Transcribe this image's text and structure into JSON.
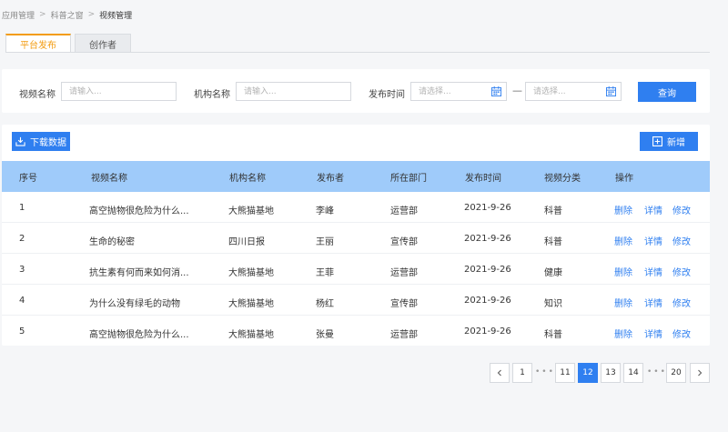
{
  "breadcrumb": {
    "items": [
      "应用管理",
      "科普之窗",
      "视频管理"
    ],
    "separator": ">"
  },
  "tabs": [
    {
      "label": "平台发布",
      "active": true
    },
    {
      "label": "创作者",
      "active": false
    }
  ],
  "search": {
    "video_name_label": "视频名称",
    "video_name_placeholder": "请输入...",
    "org_name_label": "机构名称",
    "org_name_placeholder": "请输入...",
    "publish_time_label": "发布时间",
    "start_placeholder": "请选择...",
    "end_placeholder": "请选择...",
    "range_separator": "—",
    "query_button": "查询"
  },
  "toolbar": {
    "download_button": "下载数据",
    "add_button": "新增"
  },
  "table": {
    "columns": [
      "序号",
      "视频名称",
      "机构名称",
      "发布者",
      "所在部门",
      "发布时间",
      "视频分类",
      "操作"
    ],
    "rows": [
      {
        "no": "1",
        "title": "高空抛物很危险为什么...",
        "org": "大熊猫基地",
        "publisher": "李峰",
        "dept": "运营部",
        "date": "2021-9-26",
        "category": "科普"
      },
      {
        "no": "2",
        "title": "生命的秘密",
        "org": "四川日报",
        "publisher": "王丽",
        "dept": "宣传部",
        "date": "2021-9-26",
        "category": "科普"
      },
      {
        "no": "3",
        "title": "抗生素有何而来如何消...",
        "org": "大熊猫基地",
        "publisher": "王菲",
        "dept": "运营部",
        "date": "2021-9-26",
        "category": "健康"
      },
      {
        "no": "4",
        "title": "为什么没有绿毛的动物",
        "org": "大熊猫基地",
        "publisher": "杨红",
        "dept": "宣传部",
        "date": "2021-9-26",
        "category": "知识"
      },
      {
        "no": "5",
        "title": "高空抛物很危险为什么...",
        "org": "大熊猫基地",
        "publisher": "张曼",
        "dept": "运营部",
        "date": "2021-9-26",
        "category": "科普"
      }
    ],
    "actions": {
      "delete": "删除",
      "detail": "详情",
      "edit": "修改"
    }
  },
  "pagination": {
    "prev_icon": "chevron-left-icon",
    "next_icon": "chevron-right-icon",
    "first": "1",
    "ellipsis": "•••",
    "pages": [
      "11",
      "12",
      "13",
      "14"
    ],
    "current": "12",
    "last": "20"
  },
  "colors": {
    "primary": "#2f7ff0",
    "header_bg": "#9fcbfa",
    "tab_active": "#f39c12"
  }
}
